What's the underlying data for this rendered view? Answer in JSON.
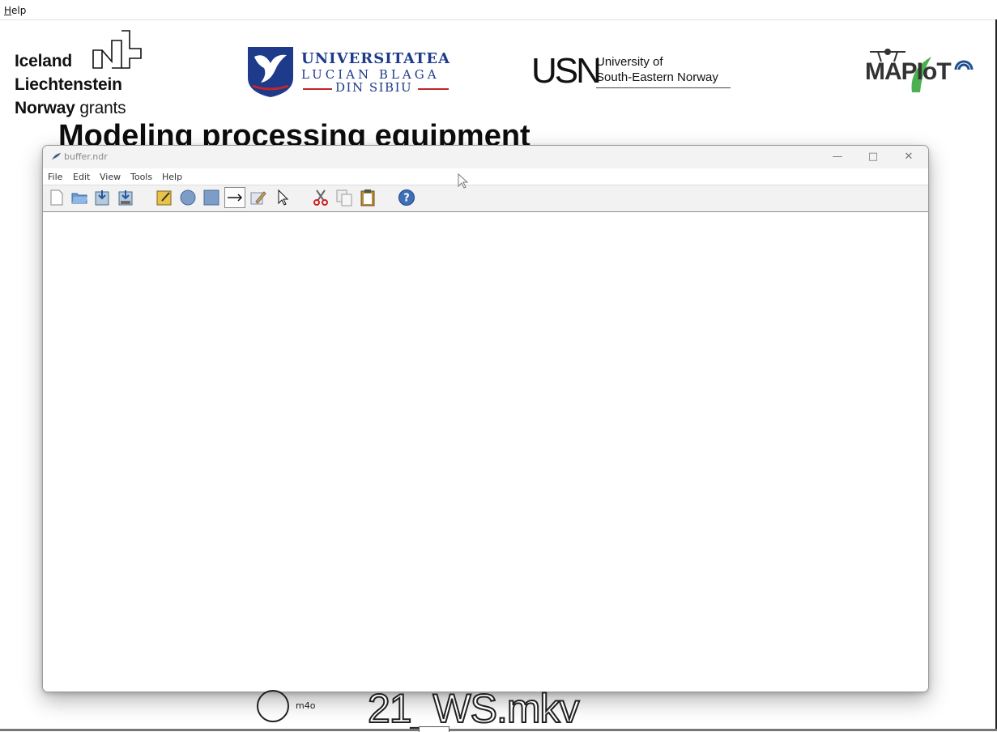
{
  "outer_menu": {
    "help_label": "Help"
  },
  "logos": {
    "ieln": {
      "line1": "Iceland",
      "line2": "Liechtenstein",
      "line3_bold": "Norway",
      "line3_light": "grants"
    },
    "ulbs": {
      "line1": "UNIVERSITATEA",
      "line2": "LUCIAN BLAGA",
      "line3": "DIN SIBIU"
    },
    "usn": {
      "mark": "USN",
      "line1": "University of",
      "line2": "South-Eastern Norway"
    },
    "mapiot": {
      "text": "MAPIoT"
    }
  },
  "slide": {
    "title": "Modeling processing equipment"
  },
  "app": {
    "title": "buffer.ndr",
    "menu": [
      "File",
      "Edit",
      "View",
      "Tools",
      "Help"
    ],
    "toolbar_icons": [
      "new-file-icon",
      "open-folder-icon",
      "save-icon",
      "save-as-icon",
      "place-tool-icon",
      "transition-circle-icon",
      "place-square-icon",
      "arc-arrow-icon",
      "edit-pencil-icon",
      "pointer-select-icon",
      "cut-scissors-icon",
      "copy-icon",
      "paste-icon",
      "help-question-icon"
    ]
  },
  "overlay": {
    "filename": "21_WS.mkv",
    "circle_label": "m4o"
  },
  "colors": {
    "ulbs_blue": "#1e3a8a",
    "ulbs_red": "#c0262d",
    "mapiot_blue": "#1f4f8f",
    "mapiot_green": "#4caf50",
    "toolbar_bg": "#f2f2f2"
  }
}
